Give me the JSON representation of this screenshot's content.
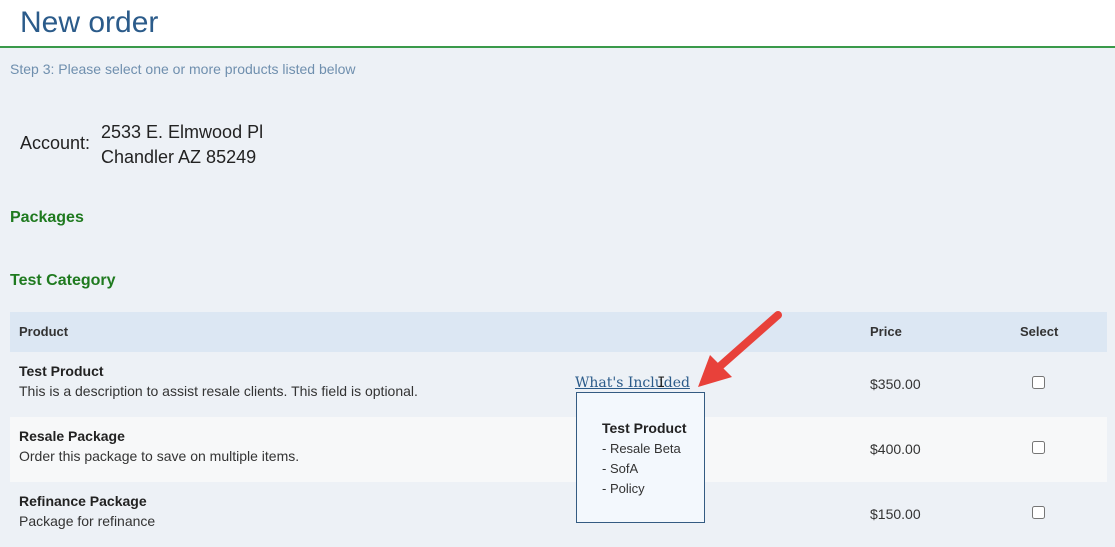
{
  "header": {
    "title": "New order"
  },
  "step": "Step 3: Please select one or more products listed below",
  "account": {
    "label": "Account:",
    "address_line1": "2533 E. Elmwood Pl",
    "address_line2": "Chandler AZ 85249"
  },
  "sections": {
    "packages": "Packages",
    "category": "Test Category"
  },
  "table": {
    "headers": {
      "product": "Product",
      "price": "Price",
      "select": "Select"
    },
    "rows": [
      {
        "name": "Test Product",
        "description": "This is a description to assist resale clients. This field is optional.",
        "link": "What's Included",
        "price": "$350.00",
        "selected": false
      },
      {
        "name": "Resale Package",
        "description": "Order this package to save on multiple items.",
        "price": "$400.00",
        "selected": false
      },
      {
        "name": "Refinance Package",
        "description": "Package for refinance",
        "price": "$150.00",
        "selected": false
      }
    ]
  },
  "tooltip": {
    "title": "Test Product",
    "items": [
      "- Resale Beta",
      "- SofA",
      "- Policy"
    ]
  },
  "annotation": {
    "arrow_color": "#e8413a",
    "icon": "arrow-icon"
  },
  "cursor": {
    "icon": "text-cursor-icon",
    "glyph": "I"
  }
}
